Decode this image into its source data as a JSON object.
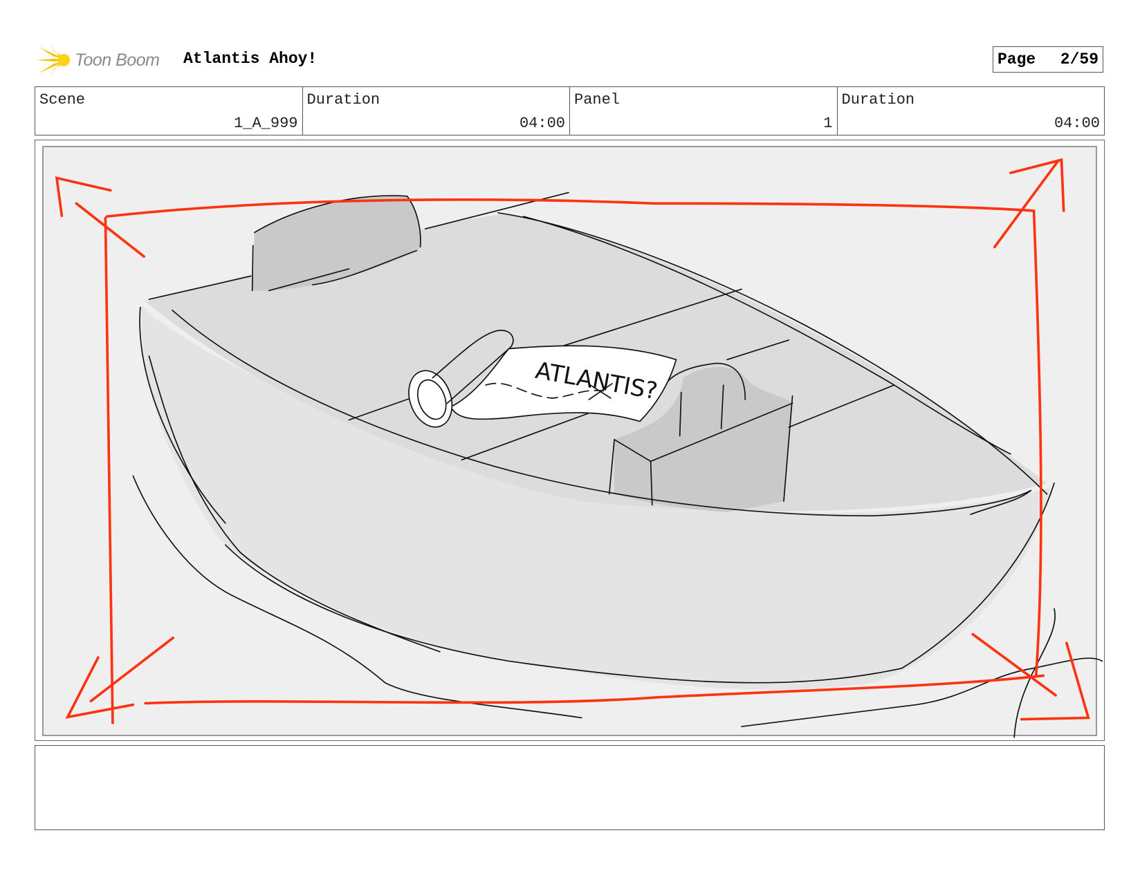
{
  "header": {
    "logo_text": "Toon Boom",
    "project_title": "Atlantis Ahoy!",
    "page_label": "Page",
    "page_value": "2/59"
  },
  "info": {
    "scene_label": "Scene",
    "scene_value": "1_A_999",
    "scene_duration_label": "Duration",
    "scene_duration_value": "04:00",
    "panel_label": "Panel",
    "panel_value": "1",
    "panel_duration_label": "Duration",
    "panel_duration_value": "04:00"
  },
  "panel": {
    "scroll_text": "ATLANTIS?",
    "camera_color": "#ff3311"
  },
  "notes": {
    "text": ""
  }
}
